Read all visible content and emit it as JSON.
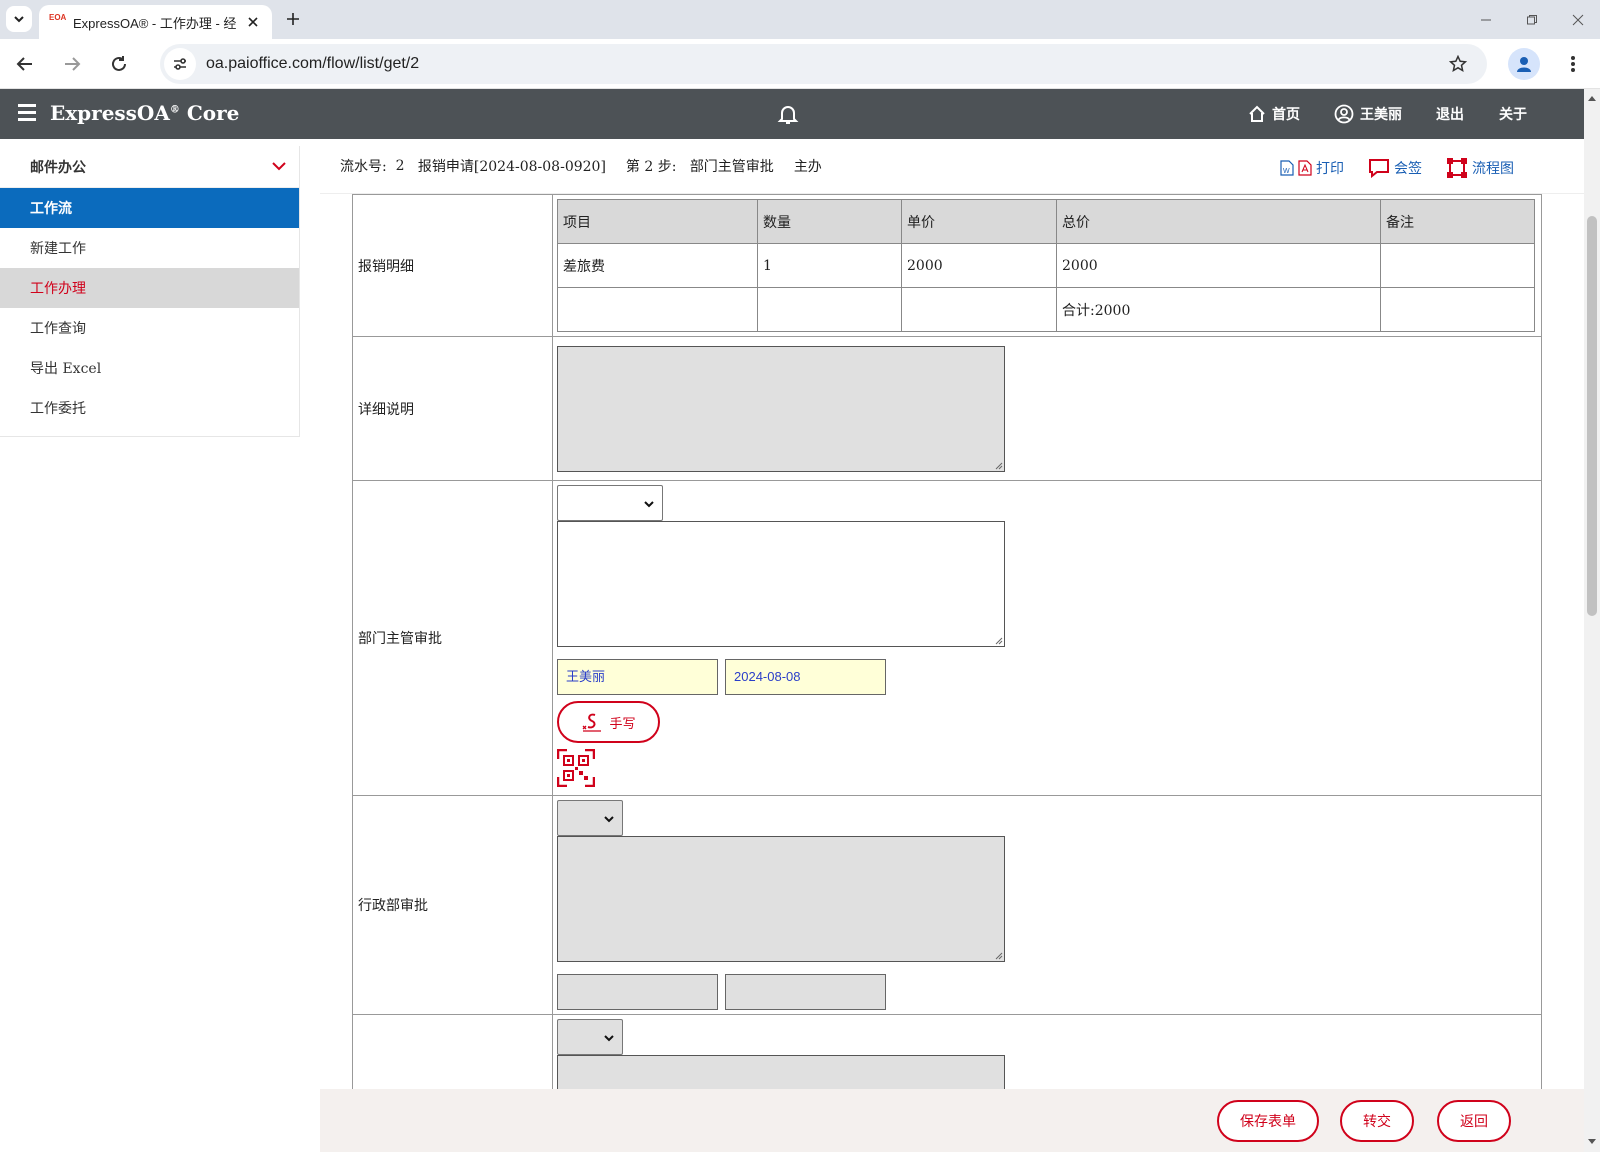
{
  "browser": {
    "tab_title": "ExpressOA® - 工作办理 - 经",
    "favicon_text": "EOA",
    "url": "oa.paioffice.com/flow/list/get/2"
  },
  "app": {
    "brand": "ExpressOA",
    "brand_mark": "®",
    "brand_suffix": " Core",
    "nav": {
      "home": "首页",
      "user": "王美丽",
      "logout": "退出",
      "about": "关于"
    }
  },
  "sidebar": {
    "group": "邮件办公",
    "active_section": "工作流",
    "items": [
      {
        "label": "新建工作"
      },
      {
        "label": "工作办理"
      },
      {
        "label": "工作查询"
      },
      {
        "label": "导出 Excel"
      },
      {
        "label": "工作委托"
      }
    ]
  },
  "infobar": {
    "serial_label": "流水号:",
    "serial_value": "2",
    "request": "报销申请[2024-08-08-0920]",
    "step": "第 2 步:",
    "step_name": "部门主管审批",
    "role": "主办",
    "print": "打印",
    "countersign": "会签",
    "flowchart": "流程图"
  },
  "form": {
    "detail_label": "报销明细",
    "detail_headers": [
      "项目",
      "数量",
      "单价",
      "总价",
      "备注"
    ],
    "detail_rows": [
      [
        "差旅费",
        "1",
        "2000",
        "2000",
        ""
      ],
      [
        "",
        "",
        "",
        "合计:2000",
        ""
      ]
    ],
    "description_label": "详细说明",
    "dept_label": "部门主管审批",
    "dept_signer": "王美丽",
    "dept_date": "2024-08-08",
    "handwrite_label": "手写",
    "admin_label": "行政部审批"
  },
  "footer": {
    "save": "保存表单",
    "transfer": "转交",
    "back": "返回"
  },
  "colors": {
    "appbar": "#4d5256",
    "active": "#0b6bbd",
    "accent_red": "#d0021b",
    "link_blue": "#1a5fb4",
    "signer_bg": "#ffffd8"
  }
}
